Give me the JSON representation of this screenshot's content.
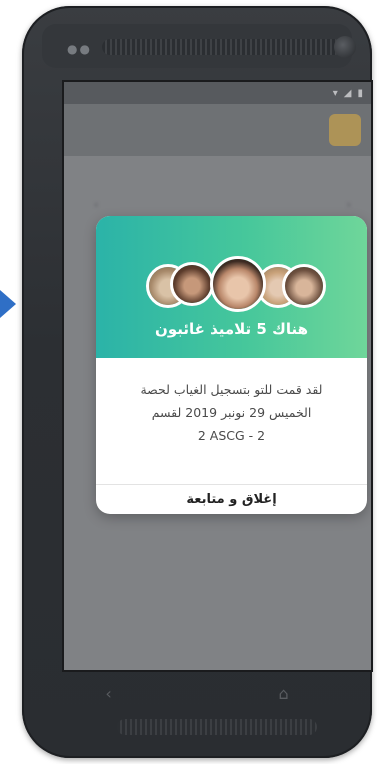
{
  "dialog": {
    "title": "هناك 5 تلاميذ غائبون",
    "message_line1": "لقد قمت للتو بتسجيل الغياب لحصة",
    "message_line2": "الخميس 29 نونبر 2019 لقسم",
    "message_line3": "2 ASCG - 2",
    "button_label": "إغلاق و متابعة"
  },
  "icons": {
    "back": "chevron-left-icon",
    "forward": "chevron-right-icon",
    "home": "home-icon",
    "nav_back": "nav-back-icon"
  },
  "colors": {
    "header_gradient_start": "#2bb3a8",
    "header_gradient_end": "#6fd69a",
    "arrow": "#2f6fc6"
  }
}
